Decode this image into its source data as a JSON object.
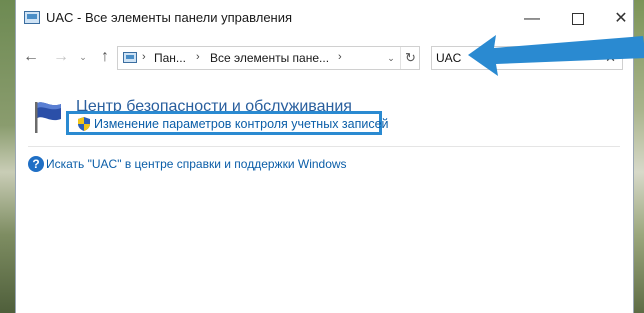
{
  "window": {
    "title": "UAC - Все элементы панели управления",
    "title_icon": "control-panel-icon"
  },
  "window_controls": {
    "minimize": "—",
    "close": "✕"
  },
  "nav": {
    "back": "←",
    "forward": "→",
    "recent_dropdown": "⌄",
    "up": "↑"
  },
  "address_bar": {
    "crumbs": [
      "Пан...",
      "Все элементы пане..."
    ],
    "separator": "›",
    "dropdown_glyph": "⌄",
    "refresh_glyph": "↻"
  },
  "search": {
    "value": "UAC",
    "clear_glyph": "✕"
  },
  "results": {
    "category_title": "Центр безопасности и обслуживания",
    "task_link": "Изменение параметров контроля учетных записей",
    "help_link": "Искать \"UAC\" в центре справки и поддержки Windows",
    "help_glyph": "?"
  },
  "colors": {
    "link": "#0b5ea8",
    "category_title": "#2a5f9e",
    "highlight_border": "#2a8ad1",
    "annotation_arrow": "#2a8ad1"
  }
}
